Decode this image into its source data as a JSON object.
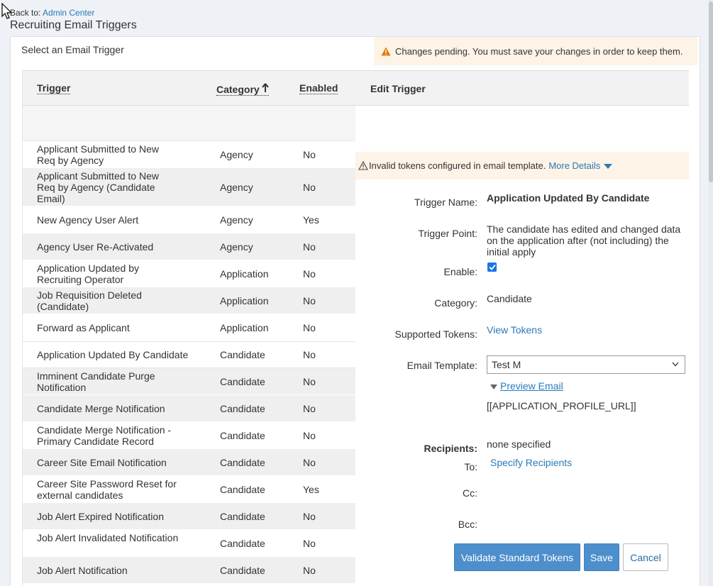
{
  "header": {
    "back_prefix": "Back to:",
    "back_link": "Admin Center",
    "title": "Recruiting Email Triggers"
  },
  "selector": {
    "label": "Select an Email Trigger"
  },
  "notice": {
    "pending_text": "Changes pending. You must save your changes in order to keep them."
  },
  "table": {
    "columns": {
      "trigger": "Trigger",
      "category": "Category",
      "enabled": "Enabled"
    },
    "rows": [
      {
        "trigger": "Applicant Submitted to New Req by Agency",
        "category": "Agency",
        "enabled": "No"
      },
      {
        "trigger": "Applicant Submitted to New Req by Agency (Candidate Email)",
        "category": "Agency",
        "enabled": "No"
      },
      {
        "trigger": "New Agency User Alert",
        "category": "Agency",
        "enabled": "Yes"
      },
      {
        "trigger": "Agency User Re-Activated",
        "category": "Agency",
        "enabled": "No"
      },
      {
        "trigger": "Application Updated by Recruiting Operator",
        "category": "Application",
        "enabled": "No"
      },
      {
        "trigger": "Job Requisition Deleted (Candidate)",
        "category": "Application",
        "enabled": "No"
      },
      {
        "trigger": "Forward as Applicant",
        "category": "Application",
        "enabled": "No"
      },
      {
        "trigger": "Application Updated By Candidate",
        "category": "Candidate",
        "enabled": "No"
      },
      {
        "trigger": "Imminent Candidate Purge Notification",
        "category": "Candidate",
        "enabled": "No"
      },
      {
        "trigger": "Candidate Merge Notification",
        "category": "Candidate",
        "enabled": "No"
      },
      {
        "trigger": "Candidate Merge Notification - Primary Candidate Record",
        "category": "Candidate",
        "enabled": "No"
      },
      {
        "trigger": "Career Site Email Notification",
        "category": "Candidate",
        "enabled": "No"
      },
      {
        "trigger": "Career Site Password Reset for external candidates",
        "category": "Candidate",
        "enabled": "Yes"
      },
      {
        "trigger": "Job Alert Expired Notification",
        "category": "Candidate",
        "enabled": "No"
      },
      {
        "trigger": "Job Alert Invalidated Notification",
        "category": "Candidate",
        "enabled": "No"
      },
      {
        "trigger": "Job Alert Notification",
        "category": "Candidate",
        "enabled": "No"
      }
    ]
  },
  "edit": {
    "heading": "Edit Trigger",
    "invalid_text": "Invalid tokens configured in email template.",
    "more_details": "More Details",
    "labels": {
      "trigger_name": "Trigger Name:",
      "trigger_point": "Trigger Point:",
      "enable": "Enable:",
      "category": "Category:",
      "supported_tokens": "Supported Tokens:",
      "email_template": "Email Template:",
      "recipients": "Recipients:",
      "to": "To:",
      "cc": "Cc:",
      "bcc": "Bcc:"
    },
    "trigger_name": "Application Updated By Candidate",
    "trigger_point": "The candidate has edited and changed data on the application after (not including) the initial apply",
    "enabled": true,
    "category": "Candidate",
    "view_tokens": "View Tokens",
    "email_template": "Test M",
    "preview_email": "Preview Email",
    "profile_url_token": "[[APPLICATION_PROFILE_URL]]",
    "recipients_value": "none specified",
    "specify_recipients": "Specify Recipients",
    "buttons": {
      "validate": "Validate Standard Tokens",
      "save": "Save",
      "cancel": "Cancel"
    }
  },
  "colors": {
    "link": "#2a7ab8",
    "primary_button": "#4d8fcc",
    "warning_bg": "#fdf3e7",
    "warning_icon": "#e07b00",
    "checkbox": "#1a73e8"
  }
}
